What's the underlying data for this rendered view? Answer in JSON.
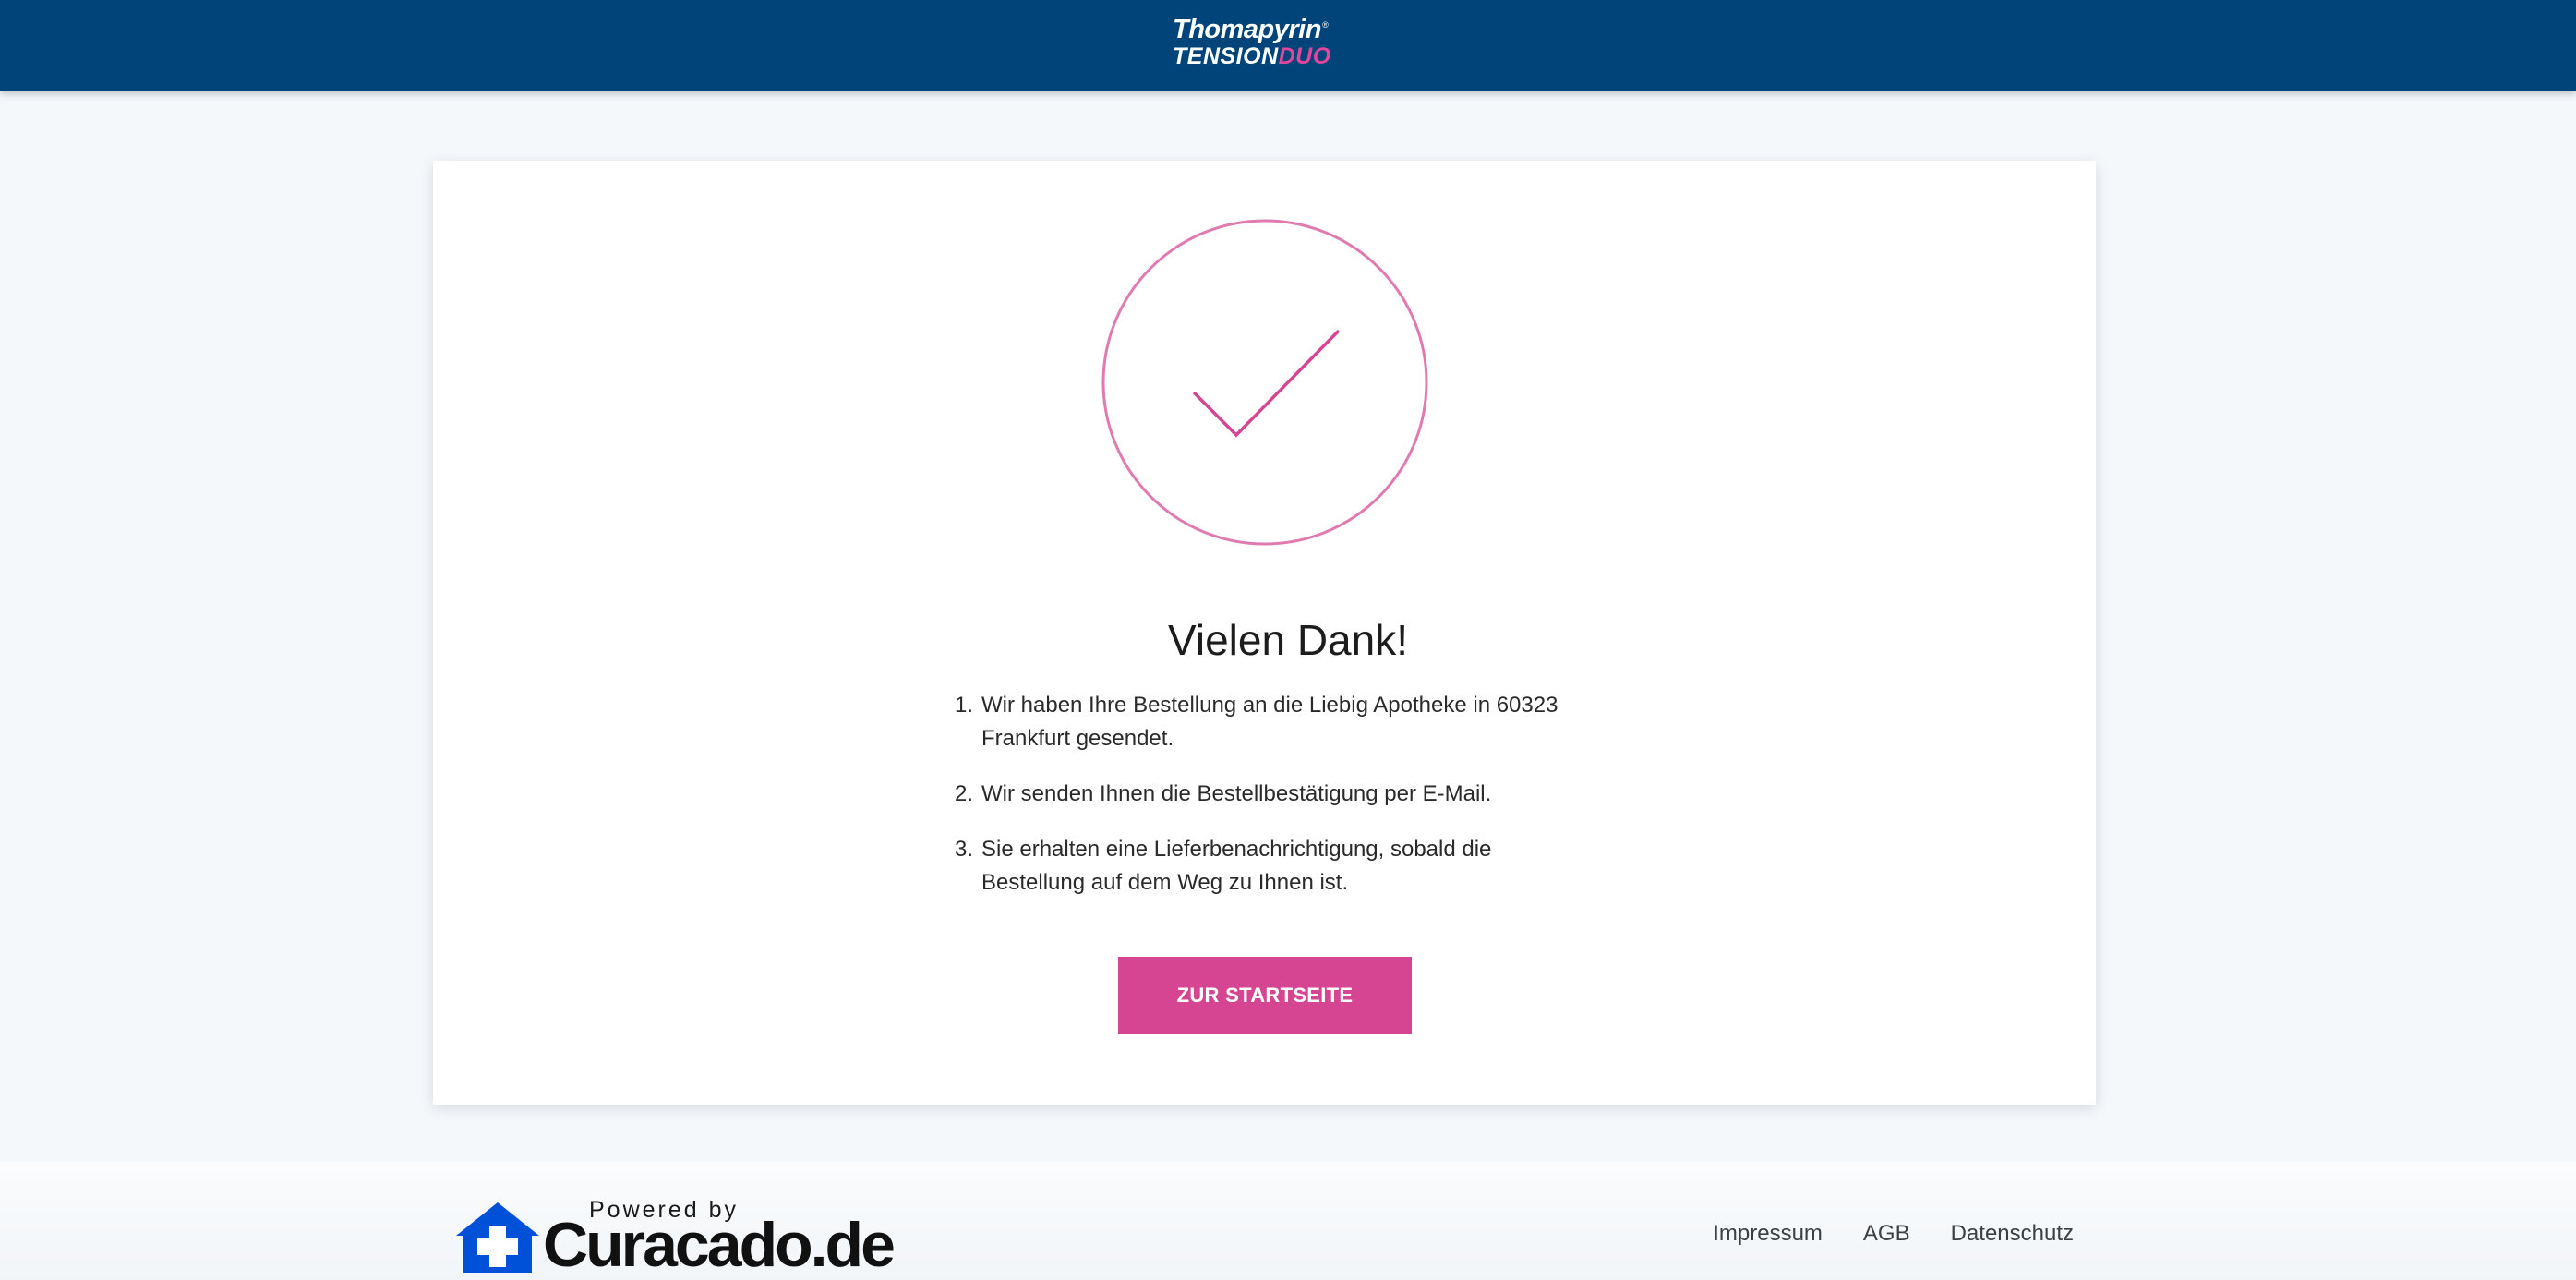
{
  "header": {
    "logo": {
      "brand": "Thomapyrin",
      "registered_mark": "®",
      "product_part1": "TENSION",
      "product_part2": "DUO"
    }
  },
  "confirmation": {
    "icon": "checkmark-circle-icon",
    "title": "Vielen Dank!",
    "steps": [
      {
        "number": "1.",
        "text": "Wir haben Ihre Bestellung an die Liebig Apotheke in 60323 Frankfurt gesendet."
      },
      {
        "number": "2.",
        "text": "Wir senden Ihnen die Bestellbestätigung per E-Mail."
      },
      {
        "number": "3.",
        "text": "Sie erhalten eine Lieferbenachrichtigung, sobald die Bestellung auf dem Weg zu Ihnen ist."
      }
    ],
    "button_label": "ZUR STARTSEITE"
  },
  "footer": {
    "powered_by": "Powered by",
    "brand": "Curacado.de",
    "brand_icon": "house-cross-icon",
    "links": [
      "Impressum",
      "AGB",
      "Datenschutz"
    ]
  },
  "colors": {
    "header_bg": "#004479",
    "accent_pink": "#d64592",
    "brand_blue": "#0050d8",
    "page_bg": "#f4f8fb"
  }
}
